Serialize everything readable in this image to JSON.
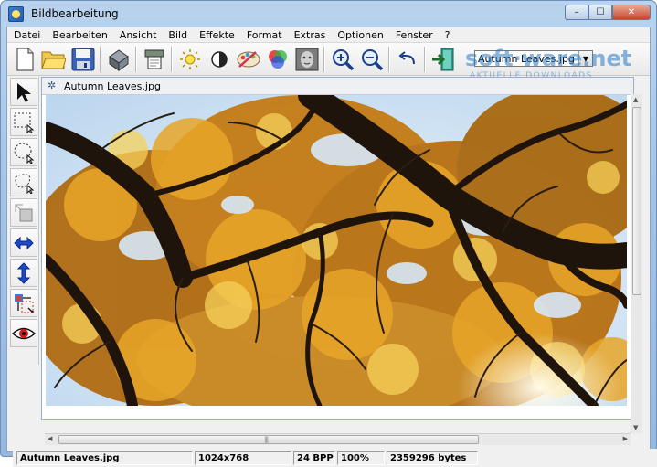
{
  "window": {
    "title": "Bildbearbeitung",
    "controls": {
      "minimize": "–",
      "maximize": "☐",
      "close": "✕"
    }
  },
  "menu": [
    "Datei",
    "Bearbeiten",
    "Ansicht",
    "Bild",
    "Effekte",
    "Format",
    "Extras",
    "Optionen",
    "Fenster",
    "?"
  ],
  "toolbar": {
    "buttons": [
      "new-file-icon",
      "open-folder-icon",
      "save-disk-icon",
      "scan-icon",
      "print-icon",
      "brightness-icon",
      "contrast-icon",
      "palette-icon",
      "rgb-color-icon",
      "grayscale-face-icon",
      "zoom-in-icon",
      "zoom-out-icon",
      "undo-icon",
      "exit-icon"
    ],
    "file_select": "Autumn Leaves.jpg"
  },
  "watermark": {
    "main": "soft·ware.net",
    "sub": "AKTUELLE DOWNLOADS"
  },
  "tools": [
    "arrow-select-icon",
    "rect-select-icon",
    "ellipse-select-icon",
    "lasso-select-icon",
    "copy-area-icon",
    "flip-horizontal-icon",
    "flip-vertical-icon",
    "resize-icon",
    "red-eye-icon"
  ],
  "document": {
    "title": "Autumn Leaves.jpg"
  },
  "status": {
    "filename": "Autumn Leaves.jpg",
    "dimensions": "1024x768",
    "depth": "24 BPP",
    "zoom": "100%",
    "size": "2359296 bytes"
  },
  "colors": {
    "sky": "#cfe3f4",
    "leaves_dark": "#b06a10",
    "leaves_light": "#f0c040",
    "branches": "#1e140c"
  }
}
